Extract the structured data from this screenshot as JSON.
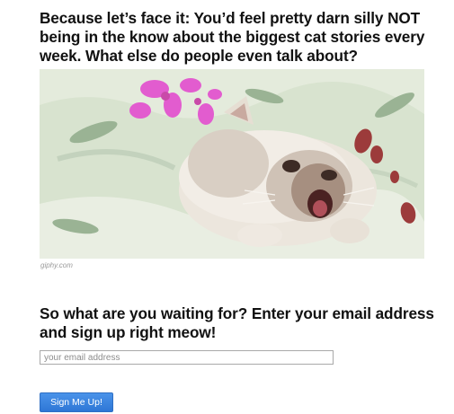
{
  "intro": {
    "headline": "Because let’s face it: You’d feel pretty darn silly NOT being in the know about the biggest cat stories every week. What else do people even talk about?"
  },
  "gif": {
    "alt": "Fluffy kitten rolling on a floral bedspread",
    "caption": "giphy.com"
  },
  "signup": {
    "prompt": "So what are you waiting for? Enter your email address and sign up right meow!",
    "email_placeholder": "your email address",
    "email_value": "",
    "button_label": "Sign Me Up!"
  },
  "colors": {
    "button": "#2e77d6",
    "text": "#111111",
    "caption": "#9a9a9a"
  }
}
